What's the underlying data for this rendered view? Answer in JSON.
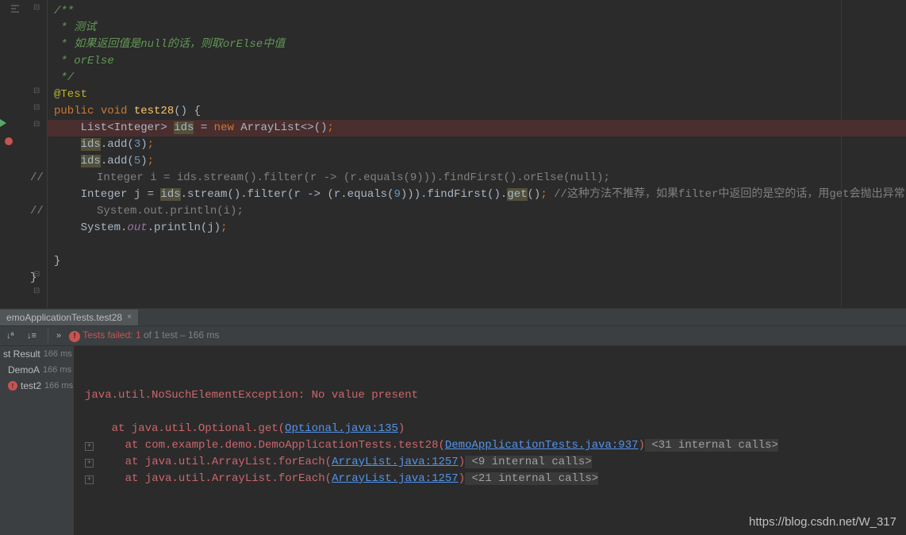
{
  "code": {
    "line1": "/**",
    "line2": " * 测试",
    "line3_a": " * 如果返回值是",
    "line3_b": "null",
    "line3_c": "的话，则取",
    "line3_d": "orElse",
    "line3_e": "中值",
    "line4_a": " * ",
    "line4_b": "orElse",
    "line5": " */",
    "line6": "@Test",
    "line7_public": "public ",
    "line7_void": "void ",
    "line7_name": "test28",
    "line7_end": "() {",
    "line8_a": "    List<Integer> ",
    "line8_b": "ids",
    "line8_c": " = ",
    "line8_new": "new ",
    "line8_d": "ArrayList<>()",
    "line8_semi": ";",
    "line9_a": "    ",
    "line9_b": "ids",
    "line9_c": ".add(",
    "line9_d": "3",
    "line9_e": ")",
    "line9_semi": ";",
    "line10_a": "    ",
    "line10_b": "ids",
    "line10_c": ".add(",
    "line10_d": "5",
    "line10_e": ")",
    "line10_semi": ";",
    "line11": "//        Integer i = ids.stream().filter(r -> (r.equals(9))).findFirst().orElse(null);",
    "line12_a": "    Integer j = ",
    "line12_b": "ids",
    "line12_c": ".stream().filter(r -> (r.equals(",
    "line12_d": "9",
    "line12_e": "))).findFirst().",
    "line12_f": "get",
    "line12_g": "()",
    "line12_semi": ";",
    "line12_comment": " //这种方法不推荐，如果filter中返回的是空的话，用get会抛出异常",
    "line13": "//        System.out.println(i);",
    "line14_a": "    System.",
    "line14_out": "out",
    "line14_b": ".println(j)",
    "line14_semi": ";",
    "line16": "}",
    "line17": "}"
  },
  "tab": {
    "label": "emoApplicationTests.test28",
    "close": "×"
  },
  "toolbar": {
    "sort1": "↓ª",
    "sort2": "↓≡",
    "expand": "»",
    "fail_label": "Tests failed: 1",
    "of_label": " of 1 test",
    "time_label": " – 166 ms"
  },
  "tree": {
    "root_label": "st Result",
    "root_time": "166 ms",
    "class_label": "DemoA",
    "class_time": "166 ms",
    "test_label": "test2",
    "test_time": "166 ms"
  },
  "console": {
    "exception": "java.util.NoSuchElementException: No value present",
    "at1_a": "    at java.util.Optional.get(",
    "at1_link": "Optional.java:135",
    "at1_b": ")",
    "at2_a": "    at com.example.demo.DemoApplicationTests.test28(",
    "at2_link": "DemoApplicationTests.java:937",
    "at2_b": ")",
    "at2_calls": " <31 internal calls>",
    "at3_a": "    at java.util.ArrayList.forEach(",
    "at3_link": "ArrayList.java:1257",
    "at3_b": ")",
    "at3_calls": " <9 internal calls>",
    "at4_a": "    at java.util.ArrayList.forEach(",
    "at4_link": "ArrayList.java:1257",
    "at4_b": ")",
    "at4_calls": " <21 internal calls>"
  },
  "watermark": "https://blog.csdn.net/W_317"
}
